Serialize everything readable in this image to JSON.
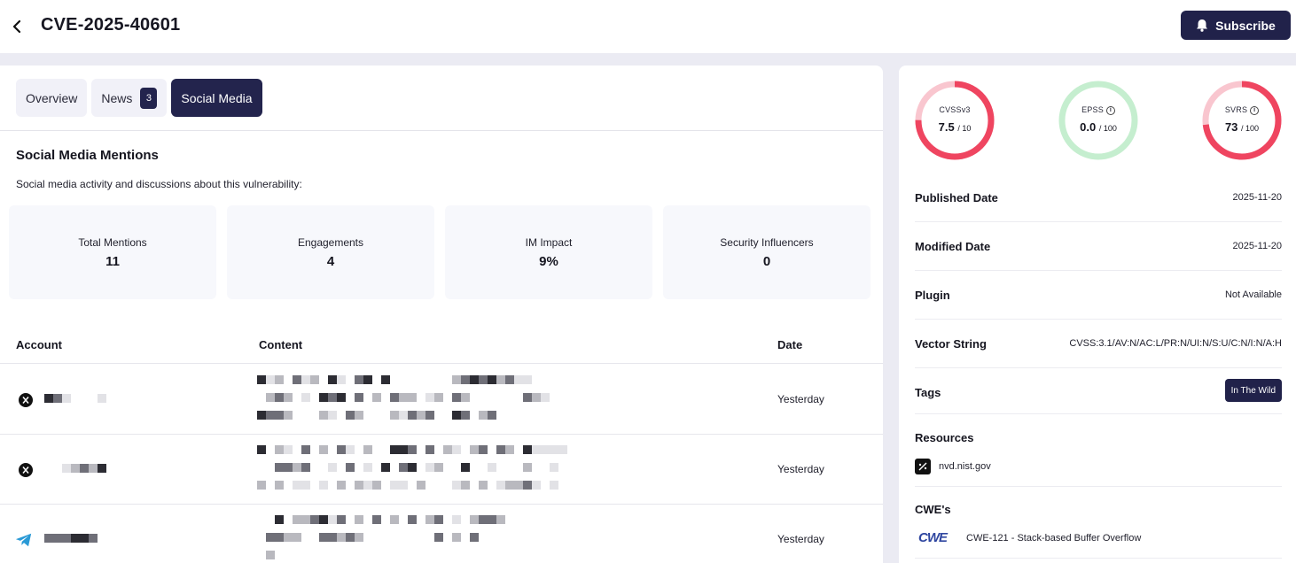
{
  "header": {
    "title": "CVE-2025-40601",
    "subscribe_label": "Subscribe"
  },
  "tabs": [
    {
      "label": "Overview",
      "active": false
    },
    {
      "label": "News",
      "badge": "3",
      "active": false
    },
    {
      "label": "Social Media",
      "active": true
    }
  ],
  "social": {
    "title": "Social Media Mentions",
    "subtitle": "Social media activity and discussions about this vulnerability:",
    "stats": [
      {
        "label": "Total Mentions",
        "value": "11"
      },
      {
        "label": "Engagements",
        "value": "4"
      },
      {
        "label": "IM Impact",
        "value": "9%"
      },
      {
        "label": "Security Influencers",
        "value": "0"
      }
    ],
    "columns": {
      "account": "Account",
      "content": "Content",
      "date": "Date"
    },
    "rows": [
      {
        "platform": "x-icon",
        "date": "Yesterday"
      },
      {
        "platform": "x-icon",
        "date": "Yesterday"
      },
      {
        "platform": "telegram-icon",
        "date": "Yesterday"
      }
    ]
  },
  "scores": [
    {
      "label": "CVSSv3",
      "value": "7.5",
      "max": "/ 10",
      "fraction": 0.75,
      "color": "#ef4560",
      "track": "#f9c6cf",
      "info": false
    },
    {
      "label": "EPSS",
      "value": "0.0",
      "max": "/ 100",
      "fraction": 0.0,
      "color": "#ef4560",
      "track": "#c5eecf",
      "info": true
    },
    {
      "label": "SVRS",
      "value": "73",
      "max": "/ 100",
      "fraction": 0.73,
      "color": "#ef4560",
      "track": "#f9c6cf",
      "info": true
    }
  ],
  "details": {
    "published_label": "Published Date",
    "published_value": "2025-11-20",
    "modified_label": "Modified Date",
    "modified_value": "2025-11-20",
    "plugin_label": "Plugin",
    "plugin_value": "Not Available",
    "vector_label": "Vector String",
    "vector_value": "CVSS:3.1/AV:N/AC:L/PR:N/UI:N/S:U/C:N/I:N/A:H",
    "tags_label": "Tags",
    "tag": "In The Wild"
  },
  "resources": {
    "title": "Resources",
    "link": "nvd.nist.gov"
  },
  "cwes": {
    "title": "CWE's",
    "logo": "CWE",
    "item": "CWE-121 - Stack-based Buffer Overflow"
  },
  "colors": {
    "accent": "#21224a",
    "gauge_red": "#ef4560"
  }
}
